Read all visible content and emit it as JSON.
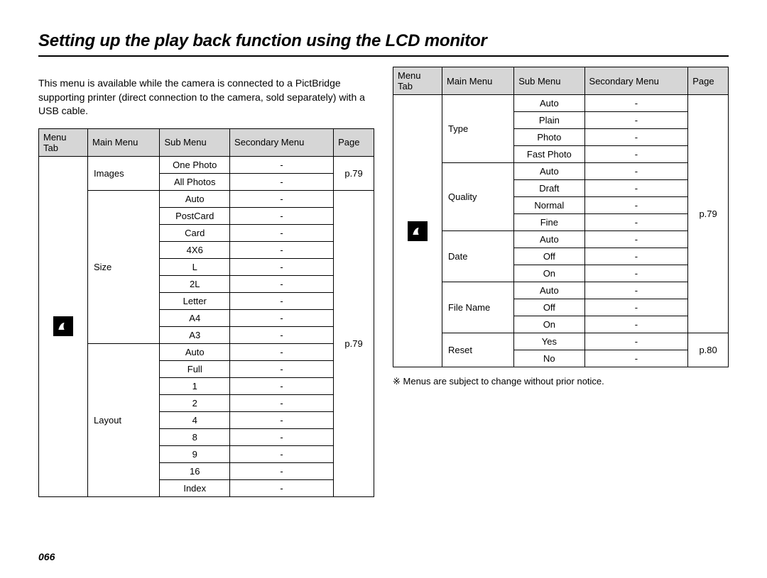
{
  "title": "Setting up the play back function using the LCD monitor",
  "intro": "This menu is available while the camera is connected to a PictBridge supporting printer (direct connection to the camera, sold separately) with a USB cable.",
  "headers": {
    "menu_tab": "Menu Tab",
    "main_menu": "Main Menu",
    "sub_menu": "Sub Menu",
    "secondary_menu": "Secondary Menu",
    "page": "Page"
  },
  "dash": "-",
  "page_number": "066",
  "footnote": "※ Menus are subject to change without prior notice.",
  "icon_name": "pictbridge-icon",
  "left_table": {
    "page_ref_0": "p.79",
    "page_ref_1": "p.79",
    "groups": [
      {
        "main": "Images",
        "rows": [
          {
            "sub": "One Photo",
            "sec": "-"
          },
          {
            "sub": "All Photos",
            "sec": "-"
          }
        ]
      },
      {
        "main": "Size",
        "rows": [
          {
            "sub": "Auto",
            "sec": "-"
          },
          {
            "sub": "PostCard",
            "sec": "-"
          },
          {
            "sub": "Card",
            "sec": "-"
          },
          {
            "sub": "4X6",
            "sec": "-"
          },
          {
            "sub": "L",
            "sec": "-"
          },
          {
            "sub": "2L",
            "sec": "-"
          },
          {
            "sub": "Letter",
            "sec": "-"
          },
          {
            "sub": "A4",
            "sec": "-"
          },
          {
            "sub": "A3",
            "sec": "-"
          }
        ]
      },
      {
        "main": "Layout",
        "rows": [
          {
            "sub": "Auto",
            "sec": "-"
          },
          {
            "sub": "Full",
            "sec": "-"
          },
          {
            "sub": "1",
            "sec": "-"
          },
          {
            "sub": "2",
            "sec": "-"
          },
          {
            "sub": "4",
            "sec": "-"
          },
          {
            "sub": "8",
            "sec": "-"
          },
          {
            "sub": "9",
            "sec": "-"
          },
          {
            "sub": "16",
            "sec": "-"
          },
          {
            "sub": "Index",
            "sec": "-"
          }
        ]
      }
    ]
  },
  "right_table": {
    "page_ref_0": "p.79",
    "page_ref_1": "p.80",
    "groups": [
      {
        "main": "Type",
        "rows": [
          {
            "sub": "Auto",
            "sec": "-"
          },
          {
            "sub": "Plain",
            "sec": "-"
          },
          {
            "sub": "Photo",
            "sec": "-"
          },
          {
            "sub": "Fast Photo",
            "sec": "-"
          }
        ]
      },
      {
        "main": "Quality",
        "rows": [
          {
            "sub": "Auto",
            "sec": "-"
          },
          {
            "sub": "Draft",
            "sec": "-"
          },
          {
            "sub": "Normal",
            "sec": "-"
          },
          {
            "sub": "Fine",
            "sec": "-"
          }
        ]
      },
      {
        "main": "Date",
        "rows": [
          {
            "sub": "Auto",
            "sec": "-"
          },
          {
            "sub": "Off",
            "sec": "-"
          },
          {
            "sub": "On",
            "sec": "-"
          }
        ]
      },
      {
        "main": "File Name",
        "rows": [
          {
            "sub": "Auto",
            "sec": "-"
          },
          {
            "sub": "Off",
            "sec": "-"
          },
          {
            "sub": "On",
            "sec": "-"
          }
        ]
      },
      {
        "main": "Reset",
        "rows": [
          {
            "sub": "Yes",
            "sec": "-"
          },
          {
            "sub": "No",
            "sec": "-"
          }
        ]
      }
    ]
  }
}
